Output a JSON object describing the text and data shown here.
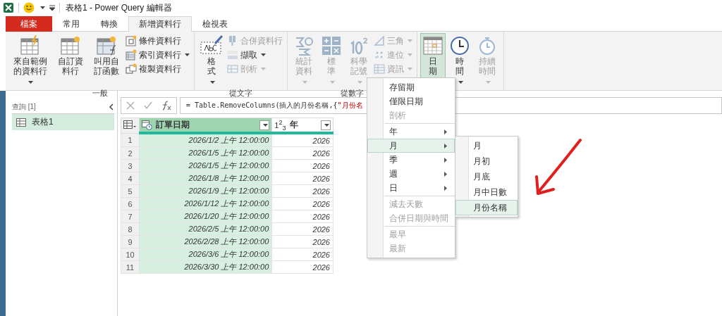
{
  "title_bar": {
    "title": "表格1 - Power Query 編輯器"
  },
  "tabs": [
    {
      "label": "檔案",
      "kind": "file",
      "selected": false
    },
    {
      "label": "常用",
      "kind": "tab",
      "selected": false
    },
    {
      "label": "轉換",
      "kind": "tab",
      "selected": false
    },
    {
      "label": "新增資料行",
      "kind": "tab",
      "selected": true
    },
    {
      "label": "檢視表",
      "kind": "tab",
      "selected": false
    }
  ],
  "ribbon": {
    "groups": [
      {
        "label": "一般",
        "buttons": [
          {
            "kind": "large",
            "label": "來自範例的資料行",
            "dropdown": true,
            "disabled": false
          },
          {
            "kind": "large",
            "label": "自訂資料行",
            "dropdown": false,
            "disabled": false
          },
          {
            "kind": "large",
            "label": "叫用自訂函數",
            "dropdown": false,
            "disabled": false
          },
          {
            "kind": "small",
            "label": "條件資料行",
            "dropdown": false,
            "disabled": false
          },
          {
            "kind": "small",
            "label": "索引資料行",
            "dropdown": true,
            "disabled": false
          },
          {
            "kind": "small",
            "label": "複製資料行",
            "dropdown": false,
            "disabled": false
          }
        ]
      },
      {
        "label": "從文字",
        "buttons": [
          {
            "kind": "large",
            "label": "格式",
            "dropdown": true,
            "disabled": false
          },
          {
            "kind": "small",
            "label": "合併資料行",
            "dropdown": false,
            "disabled": true
          },
          {
            "kind": "small",
            "label": "擷取",
            "dropdown": true,
            "disabled": false
          },
          {
            "kind": "small",
            "label": "剖析",
            "dropdown": true,
            "disabled": true
          }
        ]
      },
      {
        "label": "從數字",
        "buttons": [
          {
            "kind": "large",
            "label": "統計資料",
            "dropdown": true,
            "disabled": true
          },
          {
            "kind": "large",
            "label": "標準",
            "dropdown": true,
            "disabled": true
          },
          {
            "kind": "large",
            "label": "科學記號",
            "dropdown": true,
            "disabled": true
          },
          {
            "kind": "small",
            "label": "三角",
            "dropdown": true,
            "disabled": true
          },
          {
            "kind": "small",
            "label": "進位",
            "dropdown": true,
            "disabled": true
          },
          {
            "kind": "small",
            "label": "資訊",
            "dropdown": true,
            "disabled": true
          }
        ]
      },
      {
        "buttons": [
          {
            "kind": "large",
            "label": "日期",
            "dropdown": true,
            "disabled": false,
            "pressed": true
          },
          {
            "kind": "large",
            "label": "時間",
            "dropdown": true,
            "disabled": false,
            "pressed": false
          },
          {
            "kind": "large",
            "label": "持續時間",
            "dropdown": true,
            "disabled": true,
            "pressed": false
          }
        ]
      }
    ]
  },
  "queries_pane": {
    "header": "查詢 [1]",
    "items": [
      {
        "label": "表格1",
        "selected": true
      }
    ]
  },
  "formula_bar": {
    "parts": [
      {
        "kind": "code",
        "text": "= Table.RemoveColumns(插入的月份名稱,{"
      },
      {
        "kind": "string",
        "text": "\"月份名"
      }
    ]
  },
  "table": {
    "columns": [
      {
        "name": "訂單日期",
        "kind": "datetime",
        "selected": true
      },
      {
        "name": "年",
        "kind": "number",
        "type_label": "1$^{2}$$_{3}$",
        "selected": false
      }
    ],
    "rows": [
      {
        "num": "1",
        "cells": [
          "2026/1/2 上午 12:00:00",
          "2026"
        ]
      },
      {
        "num": "2",
        "cells": [
          "2026/1/5 上午 12:00:00",
          "2026"
        ]
      },
      {
        "num": "3",
        "cells": [
          "2026/1/5 上午 12:00:00",
          "2026"
        ]
      },
      {
        "num": "4",
        "cells": [
          "2026/1/8 上午 12:00:00",
          "2026"
        ]
      },
      {
        "num": "5",
        "cells": [
          "2026/1/9 上午 12:00:00",
          "2026"
        ]
      },
      {
        "num": "6",
        "cells": [
          "2026/1/12 上午 12:00:00",
          "2026"
        ]
      },
      {
        "num": "7",
        "cells": [
          "2026/1/20 上午 12:00:00",
          "2026"
        ]
      },
      {
        "num": "8",
        "cells": [
          "2026/2/5 上午 12:00:00",
          "2026"
        ]
      },
      {
        "num": "9",
        "cells": [
          "2026/2/28 上午 12:00:00",
          "2026"
        ]
      },
      {
        "num": "10",
        "cells": [
          "2026/3/6 上午 12:00:00",
          "2026"
        ]
      },
      {
        "num": "11",
        "cells": [
          "2026/3/30 上午 12:00:00",
          "2026"
        ]
      }
    ]
  },
  "date_menu": {
    "sections": [
      [
        {
          "label": "存留期",
          "disabled": false,
          "submenu": false,
          "selected": false
        },
        {
          "label": "僅限日期",
          "disabled": false,
          "submenu": false,
          "selected": false
        },
        {
          "label": "剖析",
          "disabled": true,
          "submenu": false,
          "selected": false
        }
      ],
      [
        {
          "label": "年",
          "disabled": false,
          "submenu": true,
          "selected": false
        },
        {
          "label": "月",
          "disabled": false,
          "submenu": true,
          "selected": true
        },
        {
          "label": "季",
          "disabled": false,
          "submenu": true,
          "selected": false
        },
        {
          "label": "週",
          "disabled": false,
          "submenu": true,
          "selected": false
        },
        {
          "label": "日",
          "disabled": false,
          "submenu": true,
          "selected": false
        }
      ],
      [
        {
          "label": "減去天數",
          "disabled": true,
          "submenu": false,
          "selected": false
        },
        {
          "label": "合併日期與時間",
          "disabled": true,
          "submenu": false,
          "selected": false
        }
      ],
      [
        {
          "label": "最早",
          "disabled": true,
          "submenu": false,
          "selected": false
        },
        {
          "label": "最新",
          "disabled": true,
          "submenu": false,
          "selected": false
        }
      ]
    ],
    "submenu": [
      {
        "label": "月",
        "selected": false
      },
      {
        "label": "月初",
        "selected": false
      },
      {
        "label": "月底",
        "selected": false
      },
      {
        "label": "月中日數",
        "selected": false
      },
      {
        "label": "月份名稱",
        "selected": true
      }
    ]
  }
}
